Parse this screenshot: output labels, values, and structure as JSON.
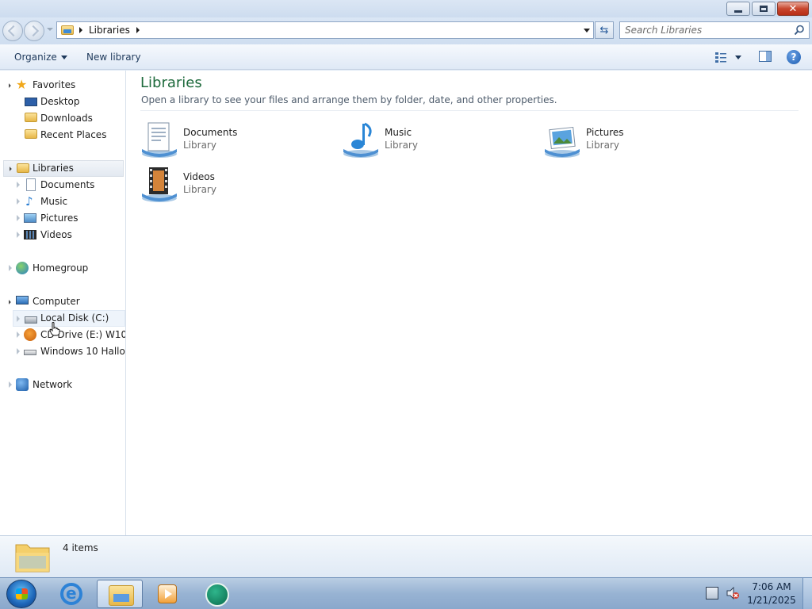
{
  "window": {
    "caption_buttons": [
      "minimize",
      "maximize",
      "close"
    ]
  },
  "address": {
    "crumb": "Libraries",
    "search_placeholder": "Search Libraries"
  },
  "commands": {
    "organize": "Organize",
    "new_library": "New library"
  },
  "nav": {
    "favorites": {
      "label": "Favorites",
      "items": [
        "Desktop",
        "Downloads",
        "Recent Places"
      ]
    },
    "libraries": {
      "label": "Libraries",
      "items": [
        "Documents",
        "Music",
        "Pictures",
        "Videos"
      ]
    },
    "homegroup": "Homegroup",
    "computer": {
      "label": "Computer",
      "items": [
        "Local Disk (C:)",
        "CD Drive (E:) W10_H",
        "Windows 10 Hallowe"
      ]
    },
    "network": "Network"
  },
  "content": {
    "title": "Libraries",
    "description": "Open a library to see your files and arrange them by folder, date, and other properties.",
    "libraries": [
      {
        "name": "Documents",
        "type": "Library",
        "icon": "documents-library-icon"
      },
      {
        "name": "Music",
        "type": "Library",
        "icon": "music-library-icon"
      },
      {
        "name": "Pictures",
        "type": "Library",
        "icon": "pictures-library-icon"
      },
      {
        "name": "Videos",
        "type": "Library",
        "icon": "videos-library-icon"
      }
    ]
  },
  "details": {
    "count": "4 items"
  },
  "taskbar": {
    "time": "7:06 AM",
    "date": "1/21/2025",
    "apps": [
      "internet-explorer",
      "windows-explorer",
      "media-player",
      "circular-app"
    ]
  },
  "colors": {
    "title_green": "#1e6a3c",
    "link_blue": "#1e395b",
    "taskbar": "#98b3d3"
  }
}
